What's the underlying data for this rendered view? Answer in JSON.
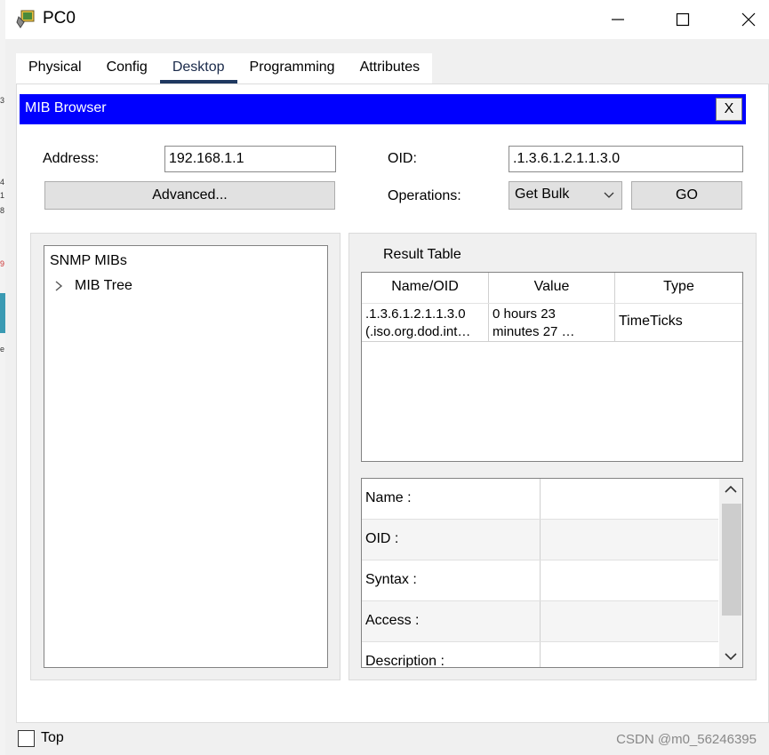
{
  "window": {
    "title": "PC0",
    "controls": {
      "minimize": "—",
      "maximize": "☐",
      "close": "✕"
    }
  },
  "tabs": [
    {
      "label": "Physical"
    },
    {
      "label": "Config"
    },
    {
      "label": "Desktop",
      "active": true
    },
    {
      "label": "Programming"
    },
    {
      "label": "Attributes"
    }
  ],
  "mib_browser": {
    "title": "MIB Browser",
    "close_label": "X",
    "address_label": "Address:",
    "address_value": "192.168.1.1",
    "oid_label": "OID:",
    "oid_value": ".1.3.6.1.2.1.1.3.0",
    "advanced_label": "Advanced...",
    "operations_label": "Operations:",
    "operation_selected": "Get Bulk",
    "go_label": "GO"
  },
  "tree": {
    "root": "SNMP MIBs",
    "child": "MIB Tree",
    "expand_glyph": "›"
  },
  "result": {
    "label": "Result Table",
    "columns": [
      "Name/OID",
      "Value",
      "Type"
    ],
    "rows": [
      {
        "name_line1": ".1.3.6.1.2.1.1.3.0",
        "name_line2": "(.iso.org.dod.int…",
        "value_line1": "0 hours 23",
        "value_line2": "minutes 27 …",
        "type": "TimeTicks"
      }
    ]
  },
  "details": {
    "rows": [
      "Name :",
      "OID :",
      "Syntax :",
      "Access :",
      "Description :"
    ]
  },
  "footer": {
    "top_label": "Top",
    "watermark": "CSDN @m0_56246395"
  },
  "colors": {
    "header_blue": "#0000ff",
    "tab_underline": "#1f3860"
  }
}
